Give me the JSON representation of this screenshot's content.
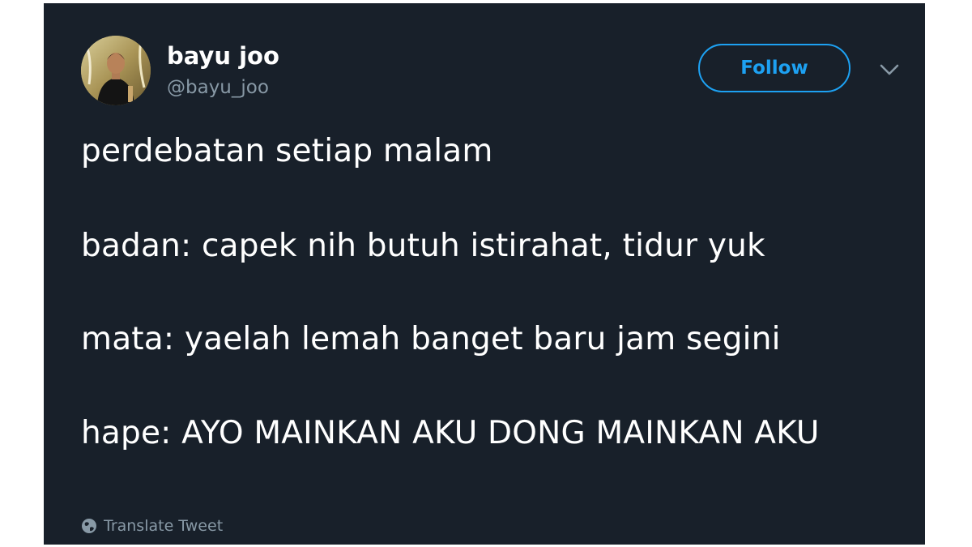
{
  "user": {
    "name": "bayu joo",
    "handle": "@bayu_joo"
  },
  "actions": {
    "follow_label": "Follow",
    "caret_icon": "chevron-down-icon"
  },
  "tweet": {
    "lines": [
      "perdebatan setiap malam",
      "badan: capek nih butuh istirahat, tidur yuk",
      "mata: yaelah lemah banget baru jam segini",
      "hape: AYO MAINKAN AKU DONG MAINKAN AKU"
    ]
  },
  "footer": {
    "translate_label": "Translate Tweet",
    "translate_icon": "globe-icon"
  },
  "colors": {
    "card_background": "#18202a",
    "accent": "#1da1f2",
    "secondary_text": "#8899a6",
    "primary_text": "#ffffff"
  }
}
